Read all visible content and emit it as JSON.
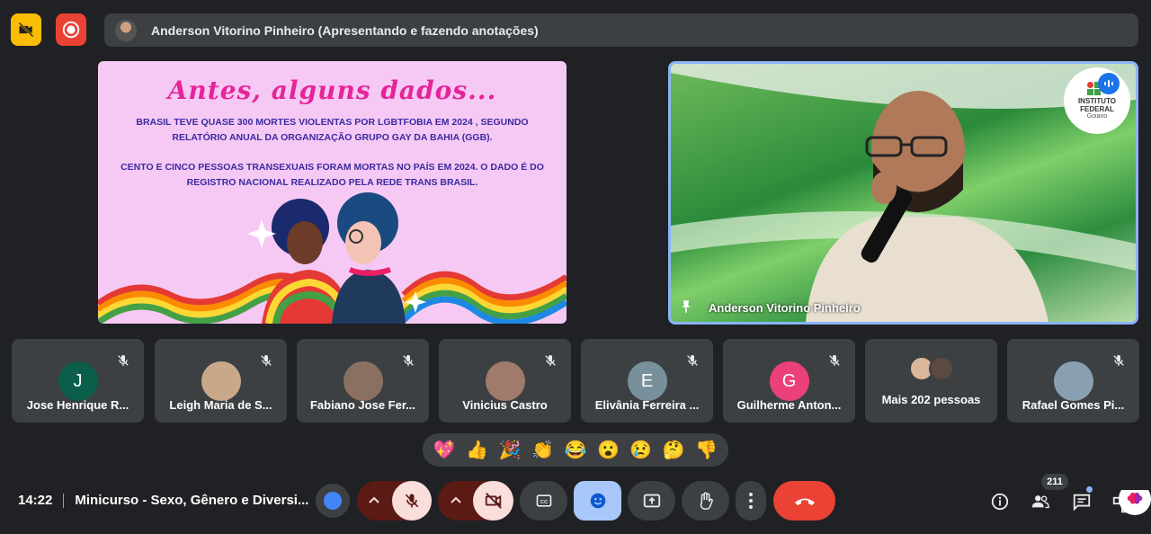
{
  "presenter_bar": {
    "text": "Anderson Vitorino Pinheiro (Apresentando e fazendo anotações)"
  },
  "slide": {
    "title": "Antes, alguns dados...",
    "paragraph1_line1": "BRASIL TEVE QUASE 300 MORTES VIOLENTAS POR LGBTFOBIA EM 2024 , SEGUNDO",
    "paragraph1_line2": "RELATÓRIO ANUAL DA ORGANIZAÇÃO GRUPO GAY DA BAHIA (GGB).",
    "paragraph2_line1": "CENTO E CINCO PESSOAS TRANSEXUAIS FORAM MORTAS NO PAÍS EM 2024. O DADO É DO",
    "paragraph2_line2": "REGISTRO NACIONAL REALIZADO PELA REDE TRANS BRASIL."
  },
  "camera": {
    "name": "Anderson Vitorino Pinheiro",
    "logo_line1": "INSTITUTO",
    "logo_line2": "FEDERAL",
    "logo_line3": "Goiano"
  },
  "participants": [
    {
      "initial": "J",
      "name": "Jose Henrique R...",
      "color": "#0b5f4a"
    },
    {
      "initial": "",
      "name": "Leigh Maria de S...",
      "color": "#c9a88a"
    },
    {
      "initial": "",
      "name": "Fabiano Jose Fer...",
      "color": "#8a7060"
    },
    {
      "initial": "",
      "name": "Vinicius Castro",
      "color": "#a07a6a"
    },
    {
      "initial": "E",
      "name": "Elivânia Ferreira ...",
      "color": "#78909c"
    },
    {
      "initial": "G",
      "name": "Guilherme Anton...",
      "color": "#ec407a"
    },
    {
      "initial": "",
      "name": "Mais 202 pessoas",
      "color": "#5f6368"
    },
    {
      "initial": "",
      "name": "Rafael Gomes Pi...",
      "color": "#8aa0b0"
    }
  ],
  "reactions": [
    "💖",
    "👍",
    "🎉",
    "👏",
    "😂",
    "😮",
    "😢",
    "🤔",
    "👎"
  ],
  "meeting": {
    "time": "14:22",
    "title": "Minicurso - Sexo, Gênero e Diversi..."
  },
  "people_count": "211",
  "colors": {
    "accent": "#8ab4f8",
    "end_call": "#ea4335",
    "muted_red": "#5c1a15",
    "muted_pink": "#f9dedc",
    "yellow": "#fbbc04"
  },
  "icons": [
    "camera-off-icon",
    "record-icon",
    "mic-off-icon",
    "video-off-icon",
    "captions-icon",
    "emoji-icon",
    "present-icon",
    "hand-icon",
    "more-icon",
    "end-call-icon",
    "info-icon",
    "people-icon",
    "chat-icon",
    "activities-icon"
  ]
}
